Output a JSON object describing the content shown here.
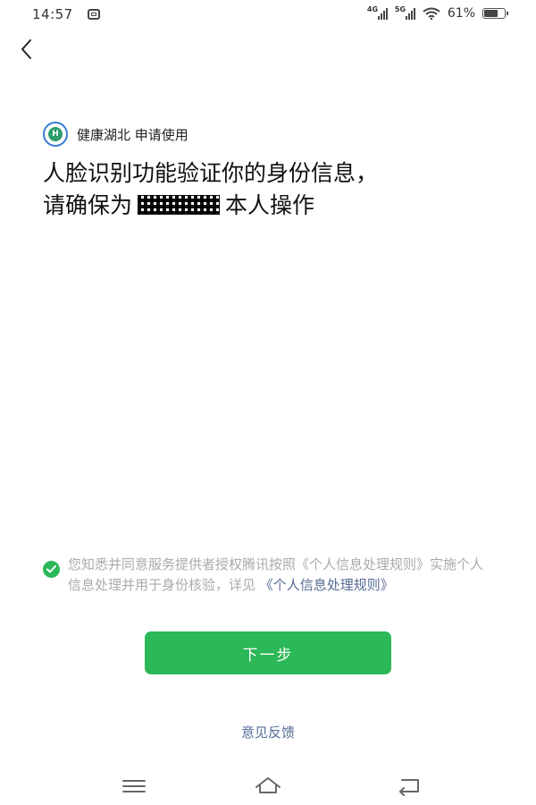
{
  "status_bar": {
    "time": "14:57",
    "battery": "61%",
    "net1": "4G",
    "net2": "5G",
    "battery_level": 0.61
  },
  "header": {
    "back_icon": "chevron-left-icon"
  },
  "app": {
    "name": "健康湖北",
    "request_text": "申请使用",
    "logo_text": "H"
  },
  "main": {
    "title_line1": "人脸识别功能验证你的身份信息，",
    "title_line2_prefix": "请确保为",
    "title_line2_suffix": "本人操作"
  },
  "consent": {
    "text": "您知悉并同意服务提供者授权腾讯按照《个人信息处理规则》实施个人信息处理并用于身份核验，详见",
    "link": "《个人信息处理规则》",
    "checked": true
  },
  "actions": {
    "next": "下一步",
    "feedback": "意见反馈"
  },
  "colors": {
    "primary": "#2bb858",
    "link": "#576b95",
    "muted_text": "#aaaaaa"
  },
  "nav": {
    "icons": [
      "menu-icon",
      "home-icon",
      "back-nav-icon"
    ]
  }
}
